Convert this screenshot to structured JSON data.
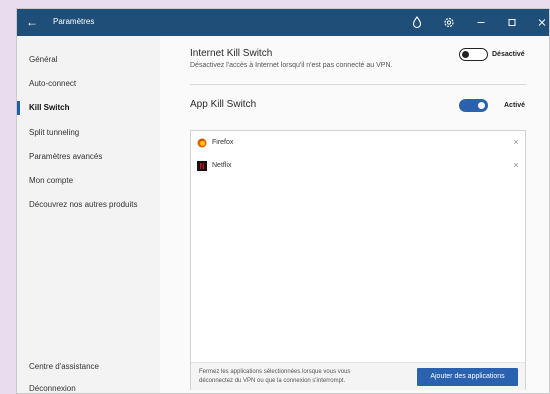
{
  "window": {
    "title": "Paramètres",
    "back_glyph": "←"
  },
  "titlebar_icons": [
    "back-icon",
    "droplet-icon",
    "gear-icon",
    "minimize-icon",
    "maximize-icon",
    "close-icon"
  ],
  "sidebar": {
    "items": [
      {
        "label": "Général"
      },
      {
        "label": "Auto-connect"
      },
      {
        "label": "Kill Switch",
        "active": true
      },
      {
        "label": "Split tunneling"
      },
      {
        "label": "Paramètres avancés"
      },
      {
        "label": "Mon compte"
      },
      {
        "label": "Découvrez nos autres produits"
      }
    ],
    "bottom_items": [
      {
        "label": "Centre d'assistance"
      },
      {
        "label": "Déconnexion"
      }
    ]
  },
  "internet_kill_switch": {
    "title": "Internet Kill Switch",
    "description": "Désactivez l'accès à Internet lorsqu'il n'est pas connecté au VPN.",
    "state": false,
    "state_label": "Désactivé"
  },
  "app_kill_switch": {
    "title": "App Kill Switch",
    "state": true,
    "state_label": "Activé",
    "apps": [
      {
        "name": "Firefox",
        "icon": "firefox-icon",
        "remove_glyph": "×"
      },
      {
        "name": "Netflix",
        "icon": "netflix-icon",
        "remove_glyph": "×"
      }
    ],
    "footer_text": "Fermez les applications sélectionnées lorsque vous vous déconnectez du VPN ou que la connexion s'interrompt.",
    "add_button": "Ajouter des applications"
  },
  "colors": {
    "titlebar": "#1f4e79",
    "accent": "#2a62b0"
  }
}
